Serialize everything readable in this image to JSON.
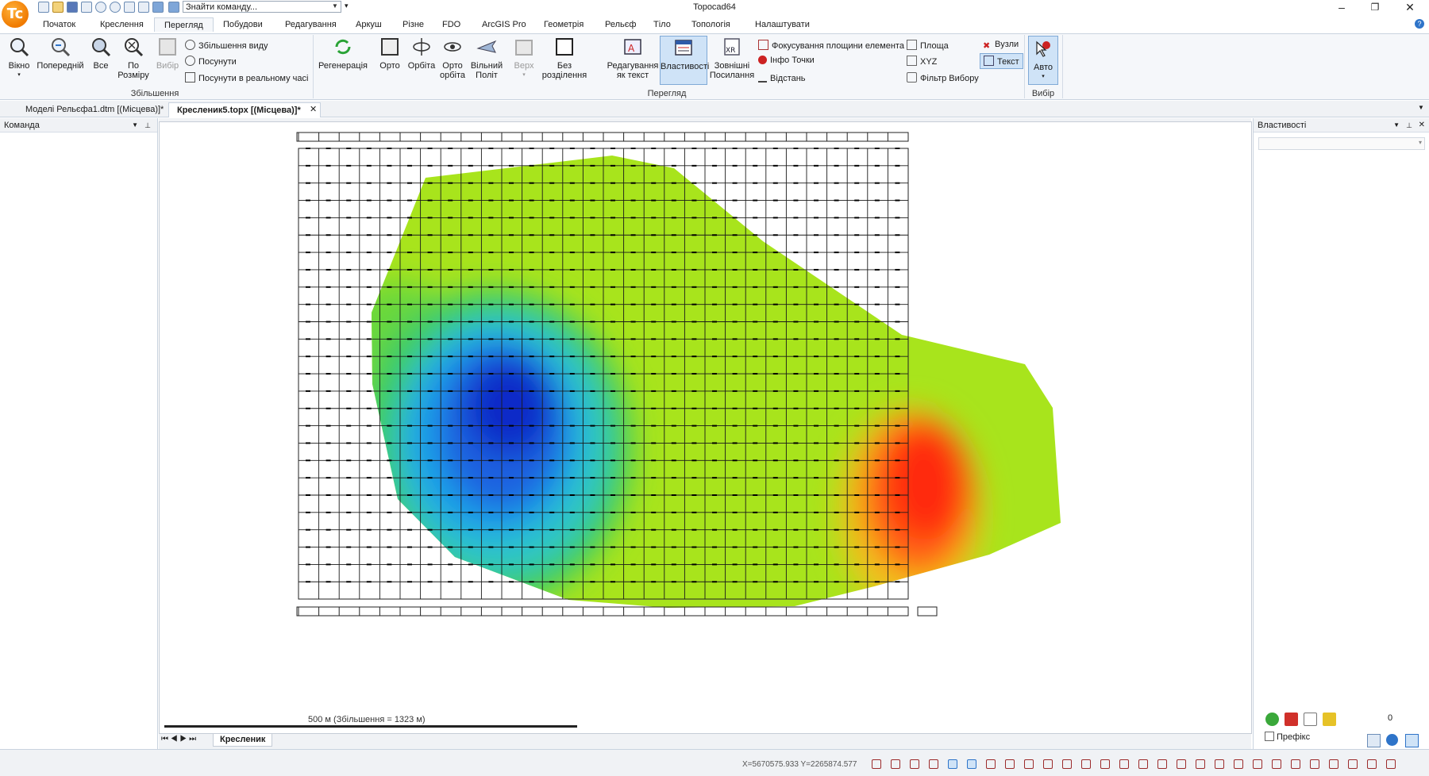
{
  "app": {
    "logo_text": "Tc",
    "title": "Topocad64",
    "command_search": "Знайти команду..."
  },
  "ribbon_tabs": [
    "Початок",
    "Креслення",
    "Перегляд",
    "Побудови",
    "Редагування",
    "Аркуш",
    "Різне",
    "FDO",
    "ArcGIS Pro",
    "Геометрія",
    "Рельєф",
    "Тіло",
    "Топологія",
    "Налаштувати"
  ],
  "ribbon": {
    "zoom_group": {
      "label": "Збільшення",
      "window": "Вікно",
      "previous": "Попередній",
      "all": "Все",
      "by_size_1": "По",
      "by_size_2": "Розміру",
      "selection": "Вибір",
      "zoom_view": "Збільшення виду",
      "pan": "Посунути",
      "pan_realtime": "Посунути в реальному часі"
    },
    "view_group": {
      "label": "Перегляд",
      "regen": "Регенерація",
      "ortho": "Орто",
      "orbit": "Орбіта",
      "ortho_orbit_1": "Орто",
      "ortho_orbit_2": "орбіта",
      "free_flight_1": "Вільний",
      "free_flight_2": "Політ",
      "top": "Верх",
      "no_split_1": "Без",
      "no_split_2": "розділення",
      "edit_text_1": "Редагування",
      "edit_text_2": "як текст",
      "properties": "Властивості",
      "xref_1": "Зовнішні",
      "xref_2": "Посилання",
      "focus_plane": "Фокусування площини елемента",
      "point_info": "Інфо Точки",
      "distance": "Відстань",
      "area": "Площа",
      "xyz": "XYZ",
      "select_filter": "Фільтр Вибору",
      "nodes": "Вузли",
      "text": "Текст"
    },
    "select_group": {
      "label": "Вибір",
      "auto": "Авто"
    }
  },
  "doc_tabs": [
    {
      "label": "Моделі Рельєфа1.dtm [(Місцева)]*",
      "active": false
    },
    {
      "label": "Кресленик5.topx [(Місцева)]*",
      "active": true
    }
  ],
  "left_panel": {
    "title": "Команда"
  },
  "right_panel": {
    "title": "Властивості",
    "prefix_label": "Префікс",
    "count": "0"
  },
  "drawing": {
    "scale_text": "500 м (Збільшення = 1323 м)",
    "sheet_tab": "Кресленик"
  },
  "status": {
    "coords": "X=5670575.933 Y=2265874.577"
  },
  "colors": {
    "accent": "#2e74c9",
    "logo": "#f07a00",
    "surface_green": "#9ee21a",
    "surface_blue": "#1030d0",
    "surface_red": "#ff3010"
  }
}
